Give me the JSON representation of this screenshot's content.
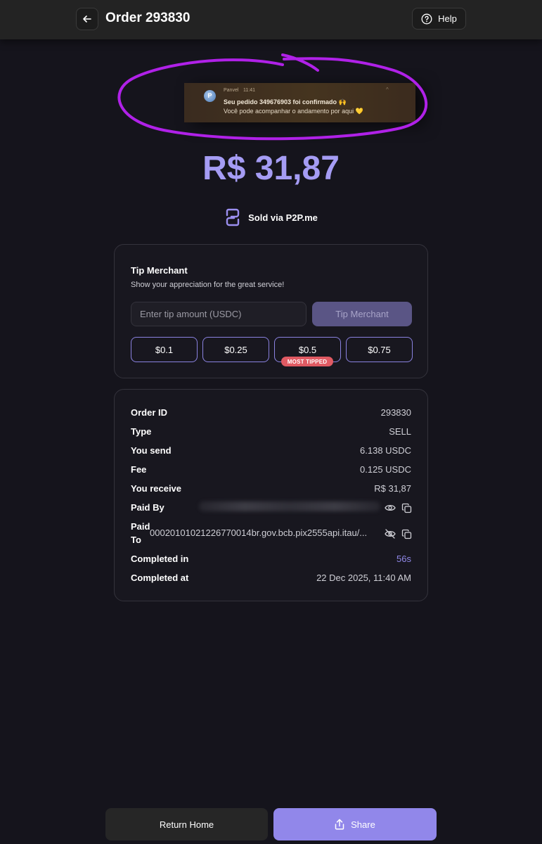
{
  "header": {
    "title": "Order 293830",
    "help_label": "Help"
  },
  "notification": {
    "app": "Panvel",
    "time": "11:41",
    "avatar_letter": "P",
    "title": "Seu pedido 349676903 foi confirmado 🙌",
    "body": "Você pode acompanhar o andamento por aqui 💛"
  },
  "amount": "R$ 31,87",
  "sold_via": "Sold via P2P.me",
  "tip": {
    "title": "Tip Merchant",
    "subtitle": "Show your appreciation for the great service!",
    "input_placeholder": "Enter tip amount (USDC)",
    "submit_label": "Tip Merchant",
    "options": [
      "$0.1",
      "$0.25",
      "$0.5",
      "$0.75"
    ],
    "badge": "MOST TIPPED"
  },
  "details": {
    "order_id_label": "Order ID",
    "order_id": "293830",
    "type_label": "Type",
    "type": "SELL",
    "send_label": "You send",
    "send": "6.138 USDC",
    "fee_label": "Fee",
    "fee": "0.125 USDC",
    "receive_label": "You receive",
    "receive": "R$ 31,87",
    "paid_by_label": "Paid By",
    "paid_to_label_1": "Paid",
    "paid_to_label_2": "To",
    "paid_to": "00020101021226770014br.gov.bcb.pix2555api.itau/...",
    "completed_in_label": "Completed in",
    "completed_in": "56s",
    "completed_at_label": "Completed at",
    "completed_at": "22 Dec 2025, 11:40 AM"
  },
  "actions": {
    "home_label": "Return Home",
    "share_label": "Share"
  },
  "colors": {
    "accent": "#a59cf4",
    "button_primary": "#9187ea",
    "badge": "#e05a63",
    "highlight": "#b021e8"
  }
}
